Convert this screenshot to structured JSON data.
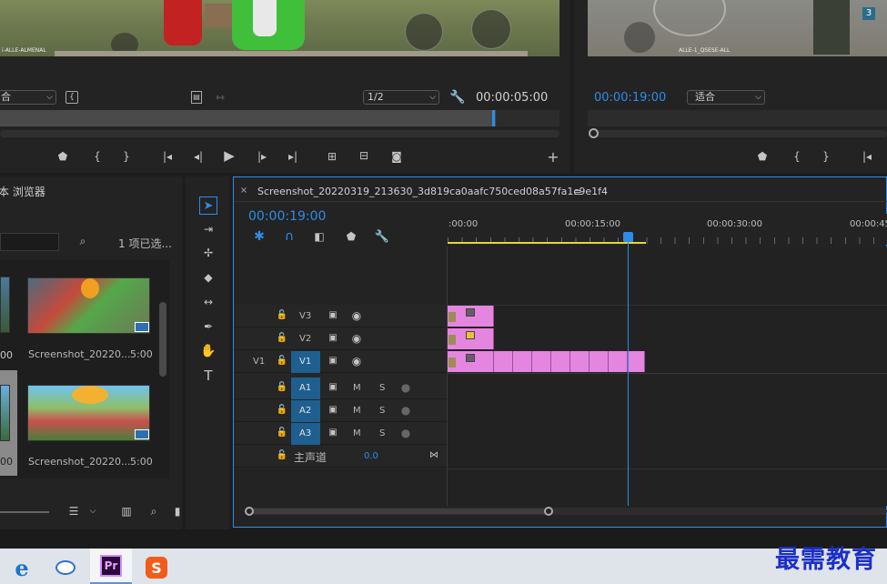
{
  "source_monitor": {
    "fit_label": "合",
    "page_label": "1/2",
    "timecode": "00:00:05:00",
    "video_overlay_text": "i-ALLE-ALMENAL"
  },
  "program_monitor": {
    "timecode": "00:00:19:00",
    "fit_label": "适合",
    "video_overlay_badge": "3",
    "video_overlay_text": "ALLE-1_QSESE-ALL"
  },
  "project_panel": {
    "title": "本 浏览器",
    "selected_count": "1 项已选...",
    "items": [
      {
        "name": "Screenshot_20220...",
        "duration": "5:00"
      },
      {
        "name": "Screenshot_20220...",
        "duration": "5:00"
      }
    ],
    "left_durations": [
      "00",
      "00"
    ]
  },
  "timeline": {
    "tab_title": "Screenshot_20220319_213630_3d819ca0aafc750ced08a57fa1c9e1f4",
    "timecode": "00:00:19:00",
    "ruler_labels": [
      ":00:00",
      "00:00:15:00",
      "00:00:30:00",
      "00:00:45"
    ],
    "tracks": {
      "v3": "V3",
      "v2": "V2",
      "v1_src": "V1",
      "v1": "V1",
      "a1": "A1",
      "a2": "A2",
      "a3": "A3",
      "mute": "M",
      "solo": "S",
      "master": "主声道",
      "master_value": "0.0"
    }
  },
  "taskbar": {
    "watermark": "最需教育",
    "apps": [
      "edge",
      "paint",
      "premiere",
      "sogou"
    ],
    "premiere_label": "Pr",
    "sogou_label": "S"
  },
  "colors": {
    "accent_blue": "#2d8ceb",
    "clip_pink": "#e486e0",
    "panel_bg": "#232323",
    "playhead": "#2d8ceb",
    "work_area": "#e8d43a"
  }
}
